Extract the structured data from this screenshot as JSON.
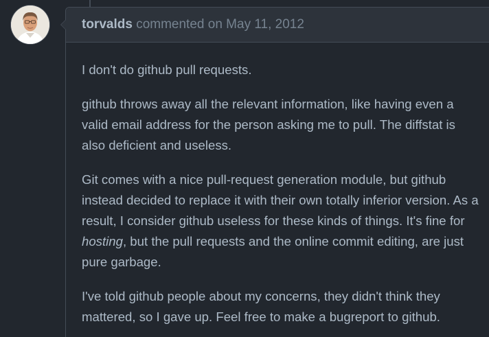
{
  "comment": {
    "author": "torvalds",
    "action": "commented on",
    "date": "May 11, 2012",
    "avatar_icon": "user-avatar-photo",
    "paragraphs": {
      "p1": "I don't do github pull requests.",
      "p2": "github throws away all the relevant information, like having even a valid email address for the person asking me to pull. The diffstat is also deficient and useless.",
      "p3_before": "Git comes with a nice pull-request generation module, but github instead decided to replace it with their own totally inferior version. As a result, I consider github useless for these kinds of things. It's fine for ",
      "p3_emphasis": "hosting",
      "p3_after": ", but the pull requests and the online commit editing, are just pure garbage.",
      "p4": "I've told github people about my concerns, they didn't think they mattered, so I gave up. Feel free to make a bugreport to github."
    }
  },
  "colors": {
    "background": "#22272e",
    "header_background": "#2d333b",
    "border": "#444c56",
    "text": "#adbac7",
    "muted_text": "#768390"
  }
}
